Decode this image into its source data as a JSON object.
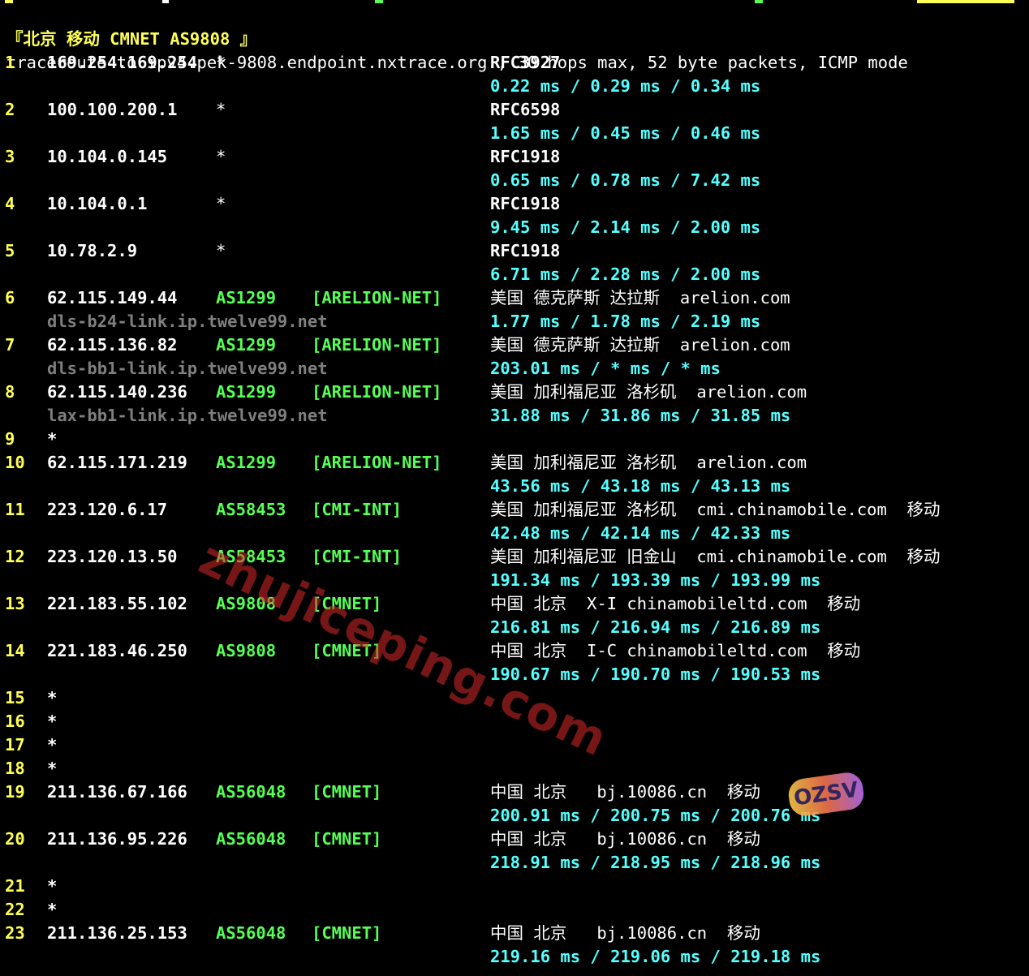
{
  "colors": {
    "background": "#000000",
    "hop_number": "#ffff55",
    "ip": "#ffffff",
    "asn": "#55ff55",
    "rtt": "#55ffff",
    "hostname": "#7f7f7f",
    "header": "#ffff55"
  },
  "header": "『北京 移动 CMNET AS9808 』",
  "command": "traceroute to ipv4.pek-9808.endpoint.nxtrace.org., 30 hops max, 52 byte packets, ICMP mode",
  "hops": [
    {
      "n": "1",
      "ip": "169.254.169.254",
      "asn": "",
      "tag": "",
      "star": "*",
      "rfc": "RFC3927",
      "geo": "",
      "rtt": "0.22 ms / 0.29 ms / 0.34 ms",
      "host": ""
    },
    {
      "n": "2",
      "ip": "100.100.200.1",
      "asn": "",
      "tag": "",
      "star": "*",
      "rfc": "RFC6598",
      "geo": "",
      "rtt": "1.65 ms / 0.45 ms / 0.46 ms",
      "host": ""
    },
    {
      "n": "3",
      "ip": "10.104.0.145",
      "asn": "",
      "tag": "",
      "star": "*",
      "rfc": "RFC1918",
      "geo": "",
      "rtt": "0.65 ms / 0.78 ms / 7.42 ms",
      "host": ""
    },
    {
      "n": "4",
      "ip": "10.104.0.1",
      "asn": "",
      "tag": "",
      "star": "*",
      "rfc": "RFC1918",
      "geo": "",
      "rtt": "9.45 ms / 2.14 ms / 2.00 ms",
      "host": ""
    },
    {
      "n": "5",
      "ip": "10.78.2.9",
      "asn": "",
      "tag": "",
      "star": "*",
      "rfc": "RFC1918",
      "geo": "",
      "rtt": "6.71 ms / 2.28 ms / 2.00 ms",
      "host": ""
    },
    {
      "n": "6",
      "ip": "62.115.149.44",
      "asn": "AS1299",
      "tag": "[ARELION-NET]",
      "star": "",
      "rfc": "",
      "geo": "美国 德克萨斯 达拉斯  arelion.com",
      "rtt": "1.77 ms / 1.78 ms / 2.19 ms",
      "host": "dls-b24-link.ip.twelve99.net"
    },
    {
      "n": "7",
      "ip": "62.115.136.82",
      "asn": "AS1299",
      "tag": "[ARELION-NET]",
      "star": "",
      "rfc": "",
      "geo": "美国 德克萨斯 达拉斯  arelion.com",
      "rtt": "203.01 ms / * ms / * ms",
      "host": "dls-bb1-link.ip.twelve99.net"
    },
    {
      "n": "8",
      "ip": "62.115.140.236",
      "asn": "AS1299",
      "tag": "[ARELION-NET]",
      "star": "",
      "rfc": "",
      "geo": "美国 加利福尼亚 洛杉矶  arelion.com",
      "rtt": "31.88 ms / 31.86 ms / 31.85 ms",
      "host": "lax-bb1-link.ip.twelve99.net"
    },
    {
      "n": "9",
      "ip": "*",
      "asn": "",
      "tag": "",
      "star": "",
      "rfc": "",
      "geo": "",
      "rtt": "",
      "host": ""
    },
    {
      "n": "10",
      "ip": "62.115.171.219",
      "asn": "AS1299",
      "tag": "[ARELION-NET]",
      "star": "",
      "rfc": "",
      "geo": "美国 加利福尼亚 洛杉矶  arelion.com",
      "rtt": "43.56 ms / 43.18 ms / 43.13 ms",
      "host": ""
    },
    {
      "n": "11",
      "ip": "223.120.6.17",
      "asn": "AS58453",
      "tag": "[CMI-INT]",
      "star": "",
      "rfc": "",
      "geo": "美国 加利福尼亚 洛杉矶  cmi.chinamobile.com  移动",
      "rtt": "42.48 ms / 42.14 ms / 42.33 ms",
      "host": ""
    },
    {
      "n": "12",
      "ip": "223.120.13.50",
      "asn": "AS58453",
      "tag": "[CMI-INT]",
      "star": "",
      "rfc": "",
      "geo": "美国 加利福尼亚 旧金山  cmi.chinamobile.com  移动",
      "rtt": "191.34 ms / 193.39 ms / 193.99 ms",
      "host": ""
    },
    {
      "n": "13",
      "ip": "221.183.55.102",
      "asn": "AS9808",
      "tag": "[CMNET]",
      "star": "",
      "rfc": "",
      "geo": "中国 北京  X-I chinamobileltd.com  移动",
      "rtt": "216.81 ms / 216.94 ms / 216.89 ms",
      "host": ""
    },
    {
      "n": "14",
      "ip": "221.183.46.250",
      "asn": "AS9808",
      "tag": "[CMNET]",
      "star": "",
      "rfc": "",
      "geo": "中国 北京  I-C chinamobileltd.com  移动",
      "rtt": "190.67 ms / 190.70 ms / 190.53 ms",
      "host": ""
    },
    {
      "n": "15",
      "ip": "*",
      "asn": "",
      "tag": "",
      "star": "",
      "rfc": "",
      "geo": "",
      "rtt": "",
      "host": ""
    },
    {
      "n": "16",
      "ip": "*",
      "asn": "",
      "tag": "",
      "star": "",
      "rfc": "",
      "geo": "",
      "rtt": "",
      "host": ""
    },
    {
      "n": "17",
      "ip": "*",
      "asn": "",
      "tag": "",
      "star": "",
      "rfc": "",
      "geo": "",
      "rtt": "",
      "host": ""
    },
    {
      "n": "18",
      "ip": "*",
      "asn": "",
      "tag": "",
      "star": "",
      "rfc": "",
      "geo": "",
      "rtt": "",
      "host": ""
    },
    {
      "n": "19",
      "ip": "211.136.67.166",
      "asn": "AS56048",
      "tag": "[CMNET]",
      "star": "",
      "rfc": "",
      "geo": "中国 北京   bj.10086.cn  移动",
      "rtt": "200.91 ms / 200.75 ms / 200.76 ms",
      "host": ""
    },
    {
      "n": "20",
      "ip": "211.136.95.226",
      "asn": "AS56048",
      "tag": "[CMNET]",
      "star": "",
      "rfc": "",
      "geo": "中国 北京   bj.10086.cn  移动",
      "rtt": "218.91 ms / 218.95 ms / 218.96 ms",
      "host": ""
    },
    {
      "n": "21",
      "ip": "*",
      "asn": "",
      "tag": "",
      "star": "",
      "rfc": "",
      "geo": "",
      "rtt": "",
      "host": ""
    },
    {
      "n": "22",
      "ip": "*",
      "asn": "",
      "tag": "",
      "star": "",
      "rfc": "",
      "geo": "",
      "rtt": "",
      "host": ""
    },
    {
      "n": "23",
      "ip": "211.136.25.153",
      "asn": "AS56048",
      "tag": "[CMNET]",
      "star": "",
      "rfc": "",
      "geo": "中国 北京   bj.10086.cn  移动",
      "rtt": "219.16 ms / 219.06 ms / 219.18 ms",
      "host": ""
    }
  ],
  "watermark": "zhujiceping.com",
  "badge": "OZSV"
}
